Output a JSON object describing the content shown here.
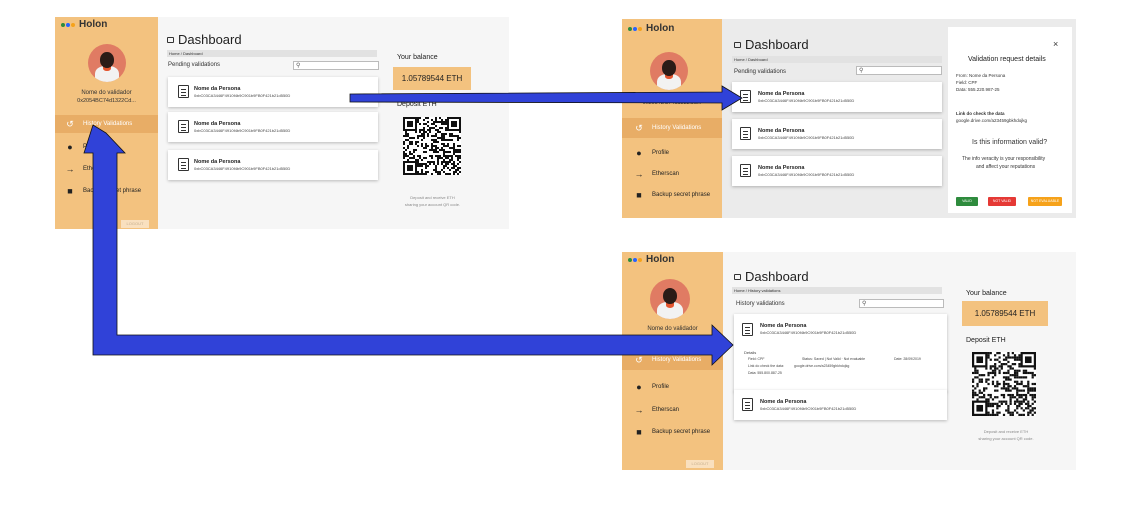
{
  "colors": {
    "sidebar": "#f3c27f",
    "sidebar_active": "#e8ad66",
    "arrow": "#3042d8",
    "valid": "#2e8b3d",
    "not_valid": "#e53935",
    "not_evaluable": "#f6a21a"
  },
  "app": {
    "brand": "Holon"
  },
  "validator": {
    "name": "Nome do validador",
    "address": "0x2054BC74d1322Cd..."
  },
  "nav": {
    "history": "History Validations",
    "profile": "Profile",
    "etherscan": "Etherscan",
    "backup": "Backup secret phrase",
    "logout": "LOGOUT"
  },
  "dashboard": {
    "title": "Dashboard",
    "breadcrumb_home": "Home / Dashboard",
    "breadcrumb_history": "Home / History validations",
    "pending_label": "Pending validations",
    "history_label": "History validations"
  },
  "persona": {
    "name": "Nome da Persona",
    "hash": "0xbC03CA3446F4910f4b9C901b9FB0F421b21d550D"
  },
  "wallet": {
    "balance_label": "Your balance",
    "balance_value": "1.05789544 ETH",
    "deposit_label": "Deposit ETH",
    "caption_line1": "Deposit and receive ETH",
    "caption_line2": "sharing your account QR code."
  },
  "modal": {
    "title": "Validation request details",
    "close": "×",
    "from": "From: Nome da Persona",
    "field": "Field: CPF",
    "data": "Data: 555.220.987-25",
    "link_label": "Link do check the data",
    "link_value": "google.drive.com/a23459gbkhdojkg",
    "question": "Is this information valid?",
    "note_line1": "The info veracity is your responsibility",
    "note_line2": "and affect your reputations",
    "btn_valid": "VALID",
    "btn_not_valid": "NOT VALID",
    "btn_not_evaluable": "NOT EVALUABLE"
  },
  "history_details": {
    "header": "Details",
    "field": "Field: CPF",
    "status": "Status: Saved | Not Valid · Not evaluable",
    "date": "Date: 28/09/2019",
    "link_prefix": "Link do check the data:",
    "link": "google.drive.com/a23459gbkhdojkg",
    "value": "Data: 555.800.887-25"
  }
}
